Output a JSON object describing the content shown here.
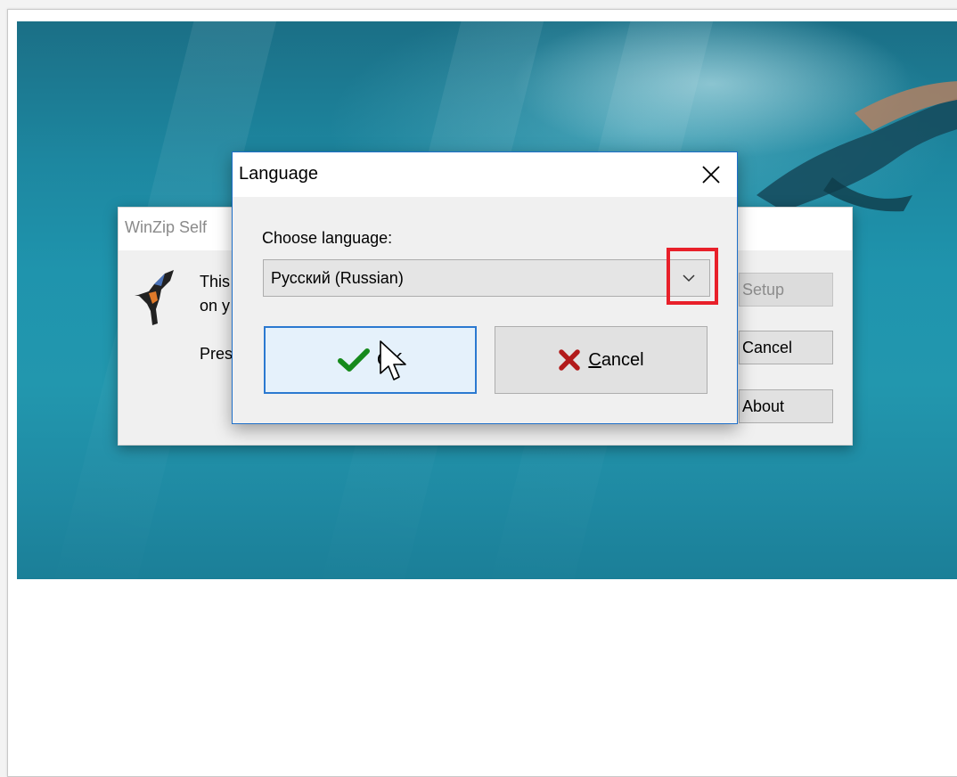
{
  "window": {
    "frame_color": "#ffffff"
  },
  "background_dialog": {
    "title": "WinZip Self",
    "line1": "This",
    "line2": "on y",
    "line3": "Pres",
    "buttons": [
      {
        "label": "Setup",
        "enabled": false
      },
      {
        "label": "Cancel",
        "enabled": true
      },
      {
        "label": "About",
        "enabled": true
      }
    ],
    "logo_icon": "hummingbird-icon"
  },
  "language_dialog": {
    "title": "Language",
    "close_icon": "close-icon",
    "choose_label": "Choose language:",
    "selected_language": "Русский (Russian)",
    "dropdown_icon": "chevron-down-icon",
    "ok_button": {
      "label": "OK",
      "icon": "checkmark-icon"
    },
    "cancel_button": {
      "label_first": "C",
      "label_rest": "ancel",
      "icon": "x-mark-icon"
    },
    "highlight_color": "#e8202a",
    "accent_color": "#2b79d0"
  }
}
